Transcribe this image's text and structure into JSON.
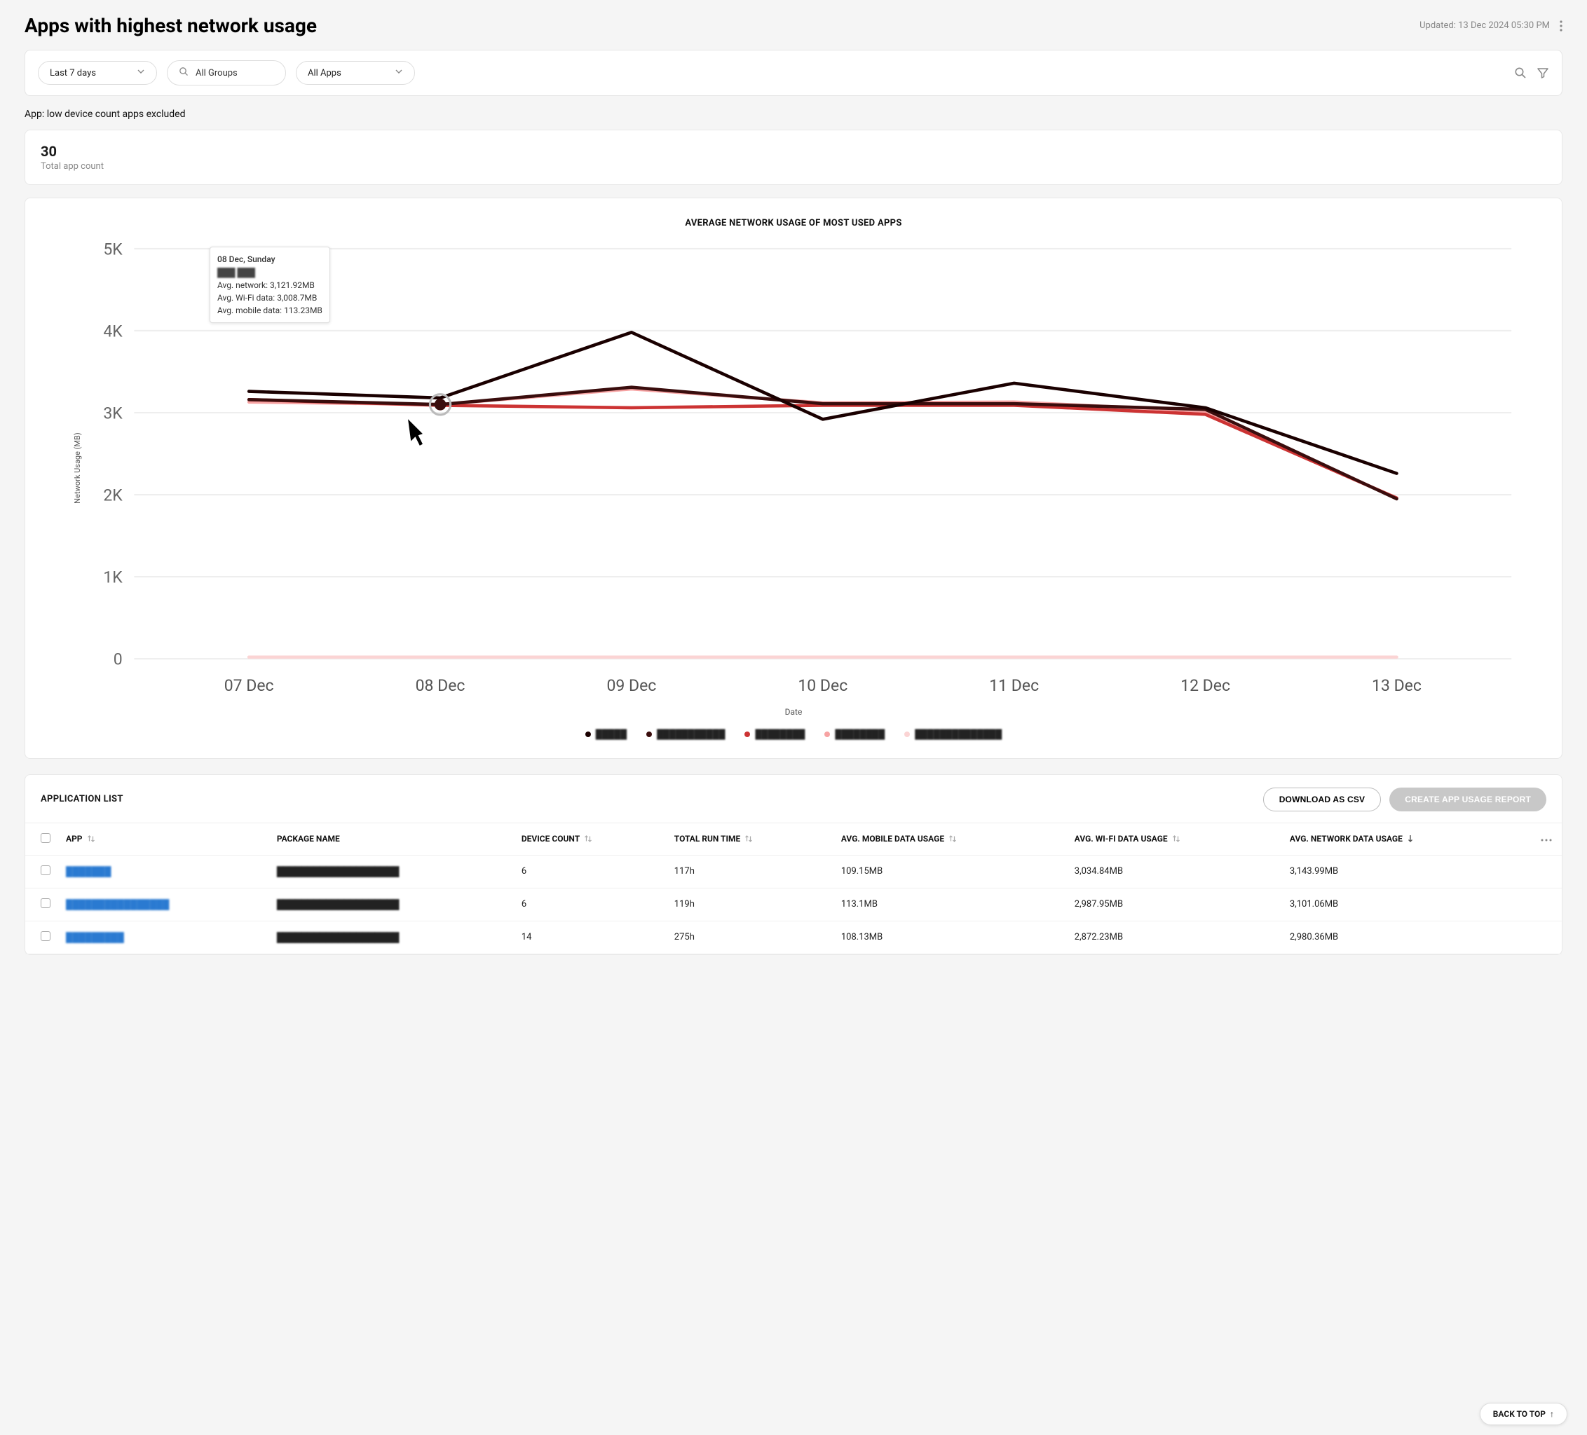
{
  "header": {
    "title": "Apps with highest network usage",
    "updated": "Updated: 13 Dec 2024 05:30 PM"
  },
  "filters": {
    "date_range": "Last 7 days",
    "groups": "All Groups",
    "apps": "All Apps"
  },
  "note": "App: low device count apps excluded",
  "summary": {
    "count": "30",
    "label": "Total app count"
  },
  "chart_data": {
    "type": "line",
    "title": "AVERAGE NETWORK USAGE OF MOST USED APPS",
    "xlabel": "Date",
    "ylabel": "Network Usage (MB)",
    "ylim": [
      0,
      5000
    ],
    "y_ticks": [
      "0",
      "1K",
      "2K",
      "3K",
      "4K",
      "5K"
    ],
    "categories": [
      "07 Dec",
      "08 Dec",
      "09 Dec",
      "10 Dec",
      "11 Dec",
      "12 Dec",
      "13 Dec"
    ],
    "series": [
      {
        "name": "Series 1",
        "color": "#1a0000",
        "values": [
          3260,
          3180,
          3980,
          2920,
          3360,
          3060,
          2260
        ]
      },
      {
        "name": "Series 2",
        "color": "#3a0d0d",
        "values": [
          3160,
          3100,
          3310,
          3110,
          3110,
          3040,
          1950
        ]
      },
      {
        "name": "Series 3",
        "color": "#cc3333",
        "values": [
          3160,
          3090,
          3060,
          3090,
          3090,
          2980,
          1960
        ]
      },
      {
        "name": "Series 4",
        "color": "#f7a3a3",
        "values": [
          3130,
          3100,
          3290,
          3120,
          3130,
          3020,
          1955
        ]
      },
      {
        "name": "Series 5",
        "color": "#fbd4d4",
        "values": [
          20,
          20,
          20,
          20,
          20,
          20,
          20
        ]
      }
    ],
    "legend": [
      "█████",
      "███████████",
      "████████",
      "████████",
      "██████████████"
    ],
    "legend_colors": [
      "#1a0000",
      "#3a0d0d",
      "#cc3333",
      "#f7a3a3",
      "#fbd4d4"
    ]
  },
  "tooltip": {
    "title": "08 Dec, Sunday",
    "series_name": "███ ███",
    "lines": [
      "Avg. network: 3,121.92MB",
      "Avg. Wi-Fi data: 3,008.7MB",
      "Avg. mobile data: 113.23MB"
    ]
  },
  "table": {
    "title": "APPLICATION LIST",
    "download_label": "DOWNLOAD AS CSV",
    "report_label": "CREATE APP USAGE REPORT",
    "columns": {
      "app": "APP",
      "package": "PACKAGE NAME",
      "device_count": "DEVICE COUNT",
      "runtime": "TOTAL RUN TIME",
      "mobile": "AVG. MOBILE DATA USAGE",
      "wifi": "AVG. WI-FI DATA USAGE",
      "network": "AVG. NETWORK DATA USAGE"
    },
    "rows": [
      {
        "app": "███████",
        "package": "████████████████████",
        "device_count": "6",
        "runtime": "117h",
        "mobile": "109.15MB",
        "wifi": "3,034.84MB",
        "network": "3,143.99MB"
      },
      {
        "app": "████████████████",
        "package": "████████████████████",
        "device_count": "6",
        "runtime": "119h",
        "mobile": "113.1MB",
        "wifi": "2,987.95MB",
        "network": "3,101.06MB"
      },
      {
        "app": "█████████",
        "package": "████████████████████",
        "device_count": "14",
        "runtime": "275h",
        "mobile": "108.13MB",
        "wifi": "2,872.23MB",
        "network": "2,980.36MB"
      }
    ]
  },
  "back_to_top": "BACK TO TOP"
}
